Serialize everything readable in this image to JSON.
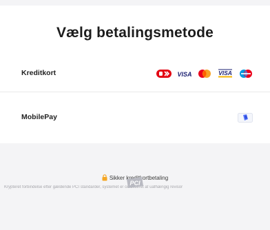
{
  "header": {
    "title": "Vælg betalingsmetode"
  },
  "methods": [
    {
      "label": "Kreditkort",
      "logos": [
        "dankort-icon",
        "visa-icon",
        "mastercard-icon",
        "visa-electron-icon",
        "maestro-icon"
      ]
    },
    {
      "label": "MobilePay",
      "logos": [
        "mobilepay-icon"
      ]
    }
  ],
  "logo_text": {
    "visa": "VISA",
    "visa_electron": "VISA"
  },
  "footer": {
    "secure_label": "Sikker kreditkortbetaling",
    "description": "Krypteret forbindelse efter gældende PCI standarder, systemet er certificeret af uafhængig revisor",
    "pci_text": "PCI"
  },
  "colors": {
    "lock": "#f5a623",
    "dankort_red": "#e30613",
    "visa_blue": "#1a1f71",
    "mastercard_red": "#eb001b",
    "mastercard_orange": "#f79e1b",
    "maestro_blue": "#0099df",
    "mobilepay_blue": "#5a78ff"
  }
}
